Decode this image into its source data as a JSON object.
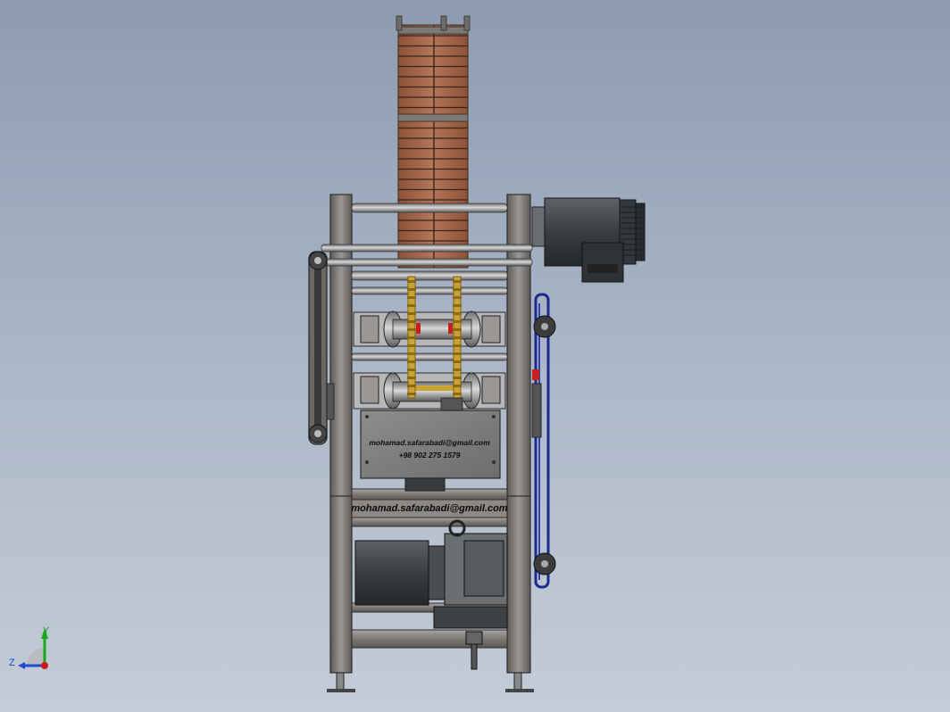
{
  "model": {
    "plate_email": "mohamad.safarabadi@gmail.com",
    "plate_phone": "+98 902 275 1579",
    "frame_email": "mohamad.safarabadi@gmail.com"
  },
  "triad": {
    "y_label": "Y",
    "z_label": "Z"
  },
  "colors": {
    "background_top": "#8d9bb0",
    "background_bottom": "#c4ccd8",
    "frame_steel": "#7d7a78",
    "wood_slat": "#a5694a",
    "motor_dark": "#3b3f42",
    "belt_blue": "#1c2a8c",
    "brass": "#c9a233",
    "accent_red": "#c8201a"
  }
}
